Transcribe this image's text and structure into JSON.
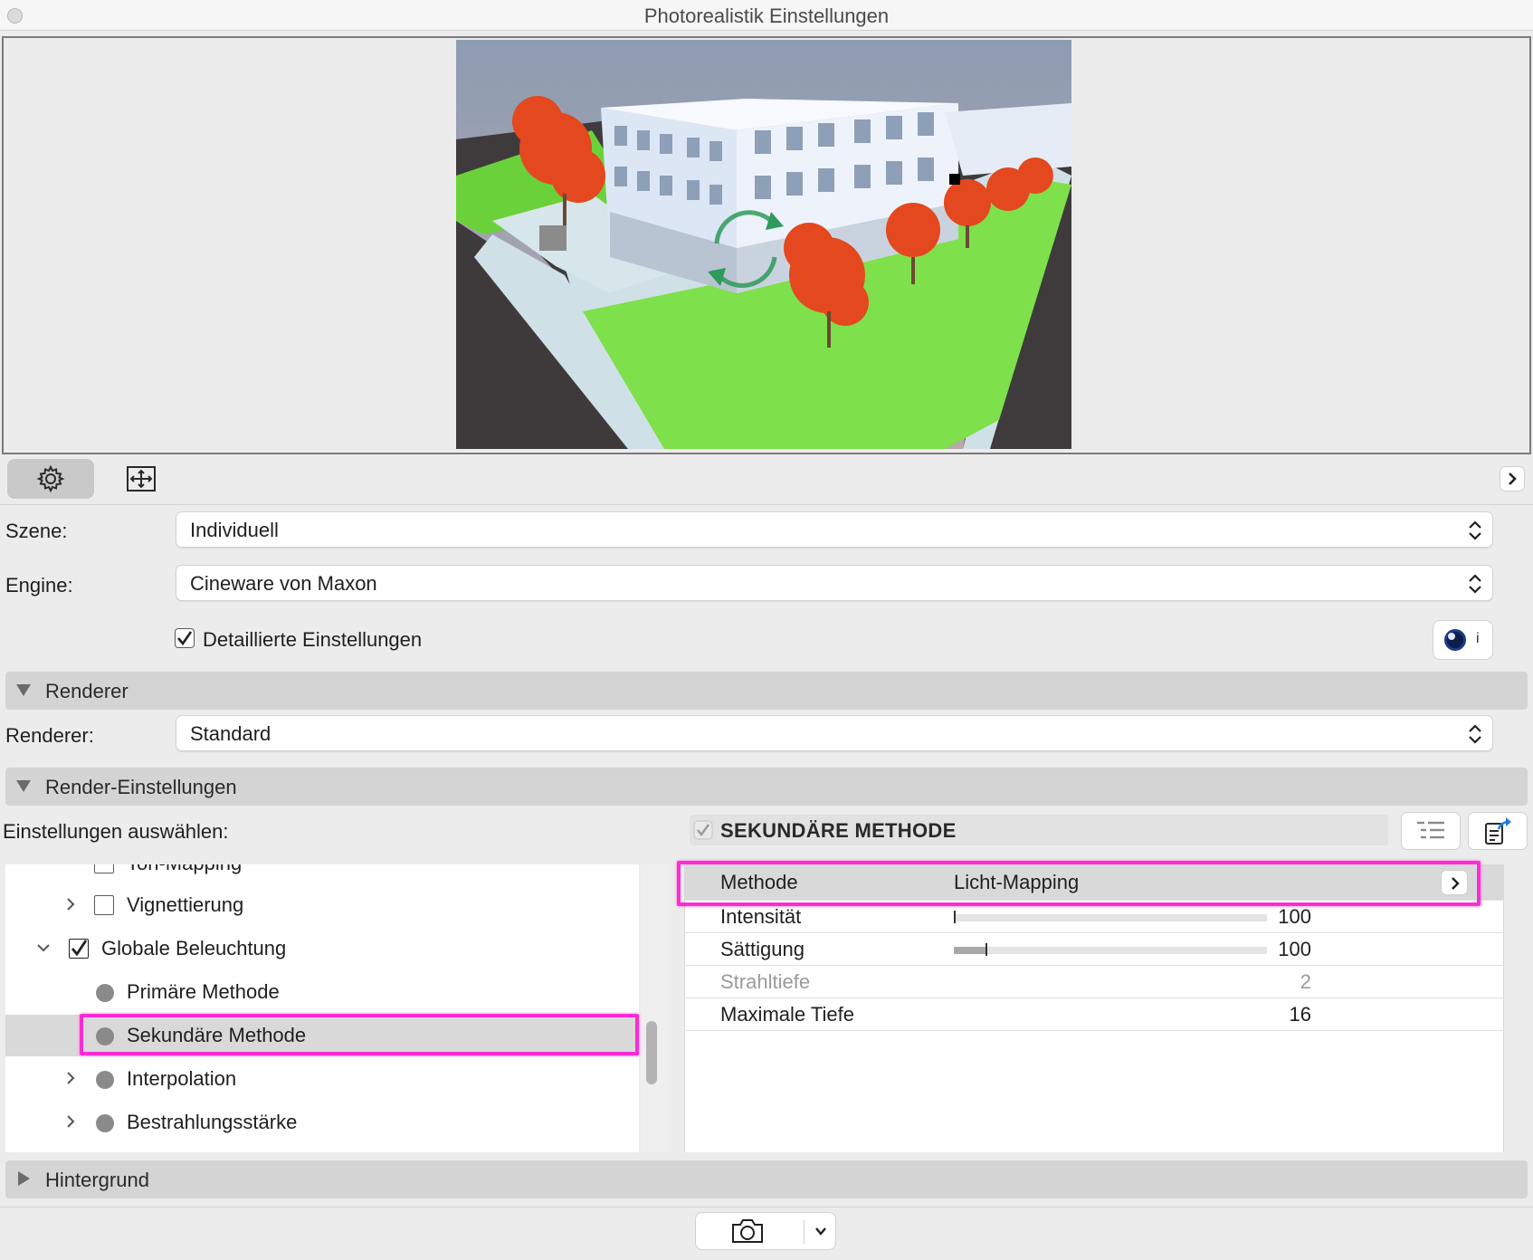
{
  "window": {
    "title": "Photorealistik Einstellungen"
  },
  "toolbar": {
    "settings_icon": "gear-icon",
    "size_icon": "resize-frame-icon",
    "expand_icon": "chevron-right-icon"
  },
  "scene": {
    "label": "Szene:",
    "value": "Individuell"
  },
  "engine": {
    "label": "Engine:",
    "value": "Cineware von Maxon"
  },
  "detailed": {
    "label": "Detaillierte Einstellungen",
    "checked": true,
    "info_icon": "cinema4d-info-icon",
    "info_text": "i"
  },
  "sections": {
    "renderer": "Renderer",
    "render_settings": "Render-Einstellungen",
    "background": "Hintergrund"
  },
  "renderer": {
    "label": "Renderer:",
    "value": "Standard"
  },
  "select_settings": {
    "label": "Einstellungen auswählen:"
  },
  "tree": {
    "items": [
      {
        "label": "Ton-Mapping",
        "type": "checkbox",
        "checked": false
      },
      {
        "label": "Vignettierung",
        "type": "checkbox",
        "checked": false
      },
      {
        "label": "Globale Beleuchtung",
        "type": "checkbox",
        "checked": true
      },
      {
        "label": "Primäre Methode",
        "type": "dot"
      },
      {
        "label": "Sekundäre Methode",
        "type": "dot",
        "selected": true
      },
      {
        "label": "Interpolation",
        "type": "dot"
      },
      {
        "label": "Bestrahlungsstärke",
        "type": "dot"
      }
    ]
  },
  "group": {
    "title": "SEKUNDÄRE METHODE",
    "checked": true
  },
  "properties": {
    "method": {
      "name": "Methode",
      "value": "Licht-Mapping"
    },
    "rows": [
      {
        "name": "Intensität",
        "value": "100",
        "slider": 0.0
      },
      {
        "name": "Sättigung",
        "value": "100",
        "slider": 0.1
      },
      {
        "name": "Strahltiefe",
        "value": "2",
        "disabled": true
      },
      {
        "name": "Maximale Tiefe",
        "value": "16"
      }
    ]
  },
  "footer": {
    "camera_icon": "camera-icon",
    "dropdown_icon": "chevron-down-icon"
  },
  "colors": {
    "highlight": "#ff2bd3",
    "accent": "#1a3b8f"
  }
}
